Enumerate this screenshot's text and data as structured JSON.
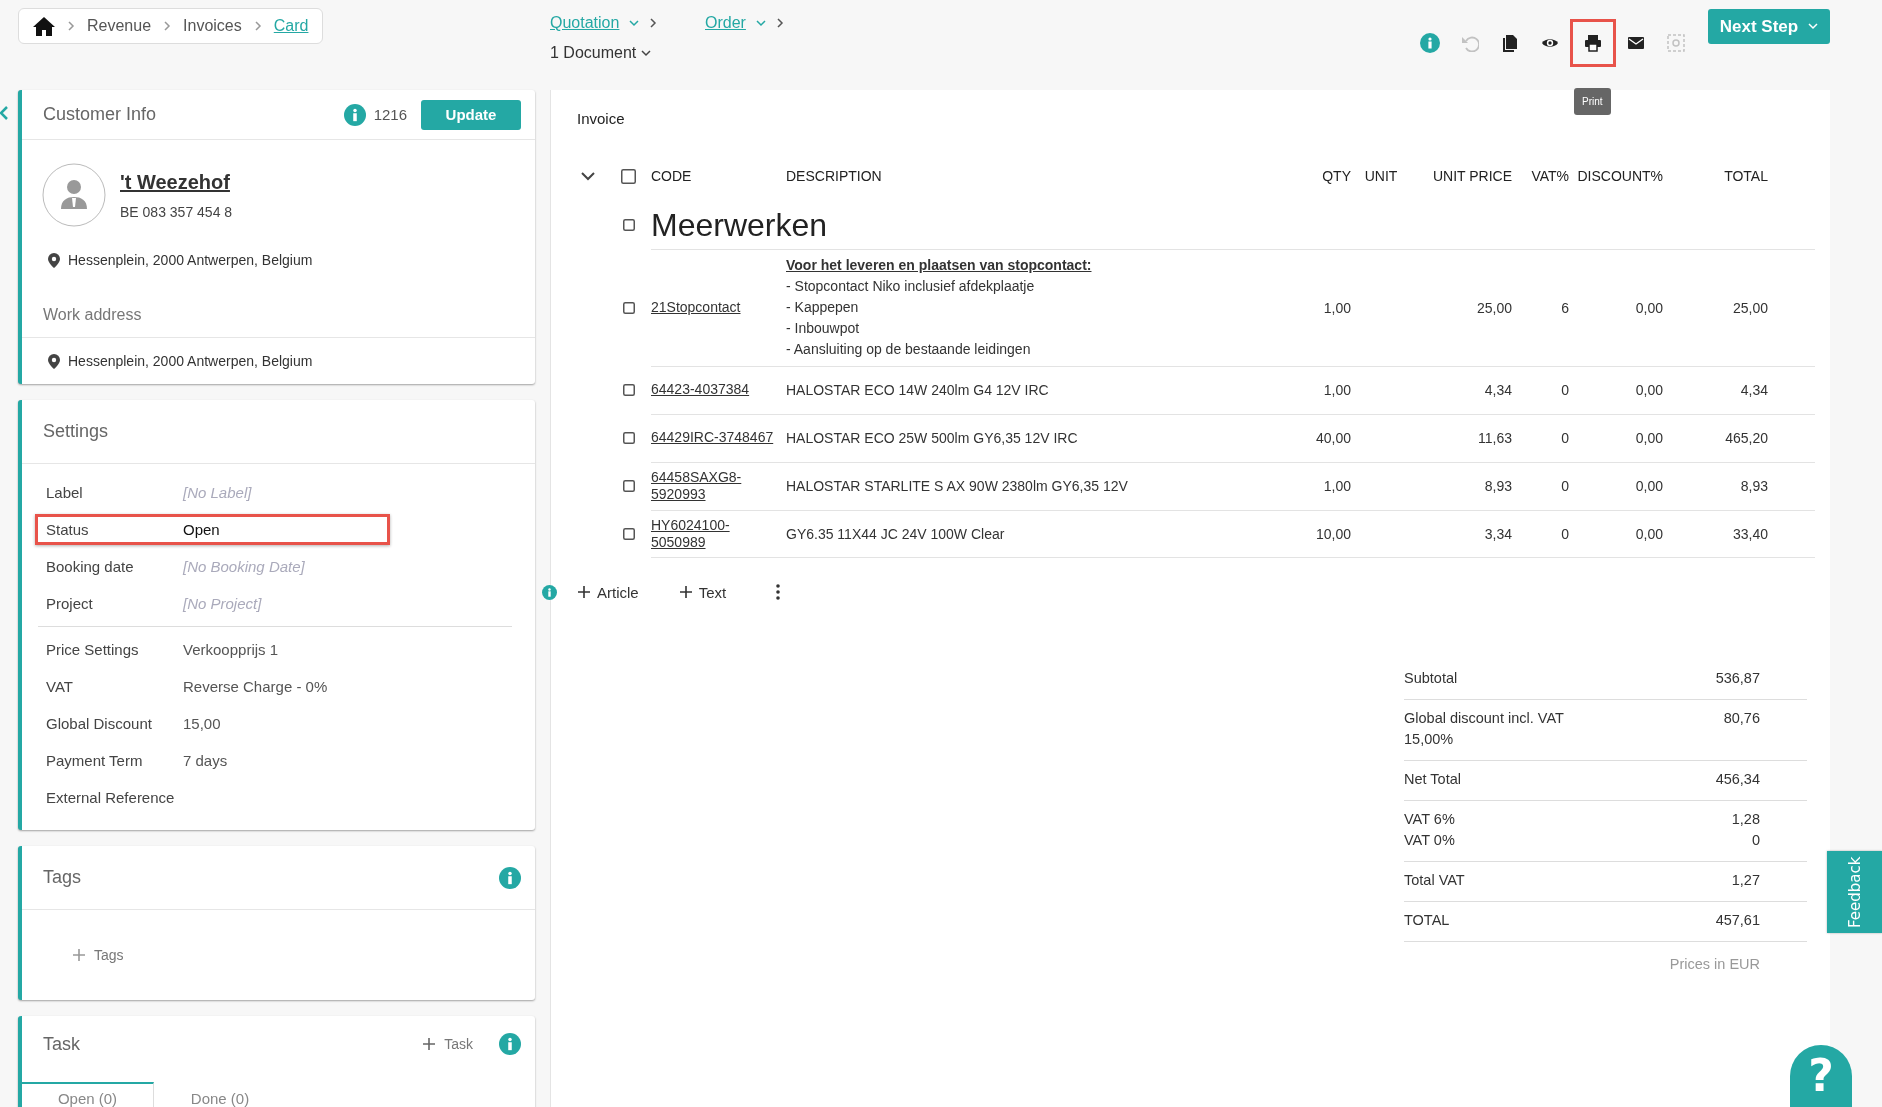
{
  "breadcrumb": [
    {
      "label": "Revenue",
      "selected": false
    },
    {
      "label": "Invoices",
      "selected": false
    },
    {
      "label": "Card",
      "selected": true
    }
  ],
  "flow": [
    {
      "label": "Quotation"
    },
    {
      "label": "Order"
    }
  ],
  "documents": "1 Document",
  "toolbar": [
    {
      "kind": "info",
      "disabled": false,
      "highlighted": false
    },
    {
      "kind": "undo",
      "disabled": true,
      "highlighted": false
    },
    {
      "kind": "copy",
      "disabled": false,
      "highlighted": false
    },
    {
      "kind": "view",
      "disabled": false,
      "highlighted": false
    },
    {
      "kind": "print",
      "disabled": false,
      "highlighted": true,
      "tooltip": "Print"
    },
    {
      "kind": "mail",
      "disabled": false,
      "highlighted": false
    },
    {
      "kind": "frame",
      "disabled": true,
      "highlighted": false
    }
  ],
  "next_step": "Next Step",
  "customer": {
    "title": "Customer Info",
    "count": "1216",
    "update": "Update",
    "name": "'t Weezehof",
    "vat_number": "BE 083 357 454 8",
    "address": "Hessenplein, 2000 Antwerpen, Belgium",
    "work_address_label": "Work address",
    "work_address": "Hessenplein, 2000 Antwerpen, Belgium"
  },
  "settings": {
    "title": "Settings",
    "groups": [
      [
        {
          "label": "Label",
          "placeholder": "[No Label]",
          "highlighted": false
        },
        {
          "label": "Status",
          "value": "Open",
          "highlighted": true
        },
        {
          "label": "Booking date",
          "placeholder": "[No Booking Date]",
          "highlighted": false
        },
        {
          "label": "Project",
          "placeholder": "[No Project]",
          "highlighted": false
        }
      ],
      [
        {
          "label": "Price Settings",
          "value": "Verkoopprijs 1",
          "highlighted": false
        },
        {
          "label": "VAT",
          "value": "Reverse Charge - 0%",
          "highlighted": false
        },
        {
          "label": "Global Discount",
          "value": "15,00",
          "highlighted": false
        },
        {
          "label": "Payment Term",
          "value": "7 days",
          "highlighted": false
        },
        {
          "label": "External Reference",
          "highlighted": false
        }
      ]
    ]
  },
  "tags": {
    "title": "Tags",
    "add": "Tags"
  },
  "task": {
    "title": "Task",
    "add": "Task",
    "tabs": [
      {
        "label": "Open (0)",
        "selected": true
      },
      {
        "label": "Done (0)",
        "selected": false
      }
    ]
  },
  "invoice": {
    "title": "Invoice",
    "select_all_checked": false,
    "columns": [
      "CODE",
      "DESCRIPTION",
      "QTY",
      "UNIT",
      "UNIT PRICE",
      "VAT%",
      "DISCOUNT%",
      "TOTAL"
    ],
    "group": {
      "title": "Meerwerken",
      "checked": false
    },
    "rows": [
      {
        "checked": false,
        "code": "21Stopcontact",
        "description_title": "Voor het leveren en plaatsen van stopcontact:",
        "description_lines": [
          "- Stopcontact Niko inclusief afdekplaatje",
          "- Kappepen",
          "- Inbouwpot",
          "- Aansluiting op de bestaande leidingen"
        ],
        "qty": "1,00",
        "unit_price": "25,00",
        "vat": "6",
        "discount": "0,00",
        "total": "25,00"
      },
      {
        "checked": false,
        "code": "64423-4037384",
        "description": "HALOSTAR ECO 14W 240lm G4 12V IRC",
        "qty": "1,00",
        "unit_price": "4,34",
        "vat": "0",
        "discount": "0,00",
        "total": "4,34"
      },
      {
        "checked": false,
        "code": "64429IRC-3748467",
        "description": "HALOSTAR ECO 25W 500lm GY6,35 12V IRC",
        "qty": "40,00",
        "unit_price": "11,63",
        "vat": "0",
        "discount": "0,00",
        "total": "465,20"
      },
      {
        "checked": false,
        "code": "64458SAXG8-5920993",
        "description": "HALOSTAR STARLITE S AX 90W 2380lm GY6,35 12V",
        "qty": "1,00",
        "unit_price": "8,93",
        "vat": "0",
        "discount": "0,00",
        "total": "8,93"
      },
      {
        "checked": false,
        "code": "HY6024100-5050989",
        "description": "GY6.35 11X44 JC 24V 100W Clear",
        "qty": "10,00",
        "unit_price": "3,34",
        "vat": "0",
        "discount": "0,00",
        "total": "33,40"
      }
    ],
    "actions": [
      "Article",
      "Text"
    ]
  },
  "totals": {
    "rows": [
      {
        "labels": [
          "Subtotal"
        ],
        "values": [
          "536,87"
        ]
      },
      {
        "labels": [
          "Global discount incl. VAT",
          "15,00%"
        ],
        "values": [
          "80,76"
        ]
      },
      {
        "labels": [
          "Net Total"
        ],
        "values": [
          "456,34"
        ]
      },
      {
        "labels": [
          "VAT 6%",
          "VAT 0%"
        ],
        "values": [
          "1,28",
          "0"
        ]
      },
      {
        "labels": [
          "Total VAT"
        ],
        "values": [
          "1,27"
        ]
      },
      {
        "labels": [
          "TOTAL"
        ],
        "values": [
          "457,61"
        ]
      }
    ],
    "note": "Prices in EUR"
  },
  "feedback": "Feedback",
  "help": "?"
}
